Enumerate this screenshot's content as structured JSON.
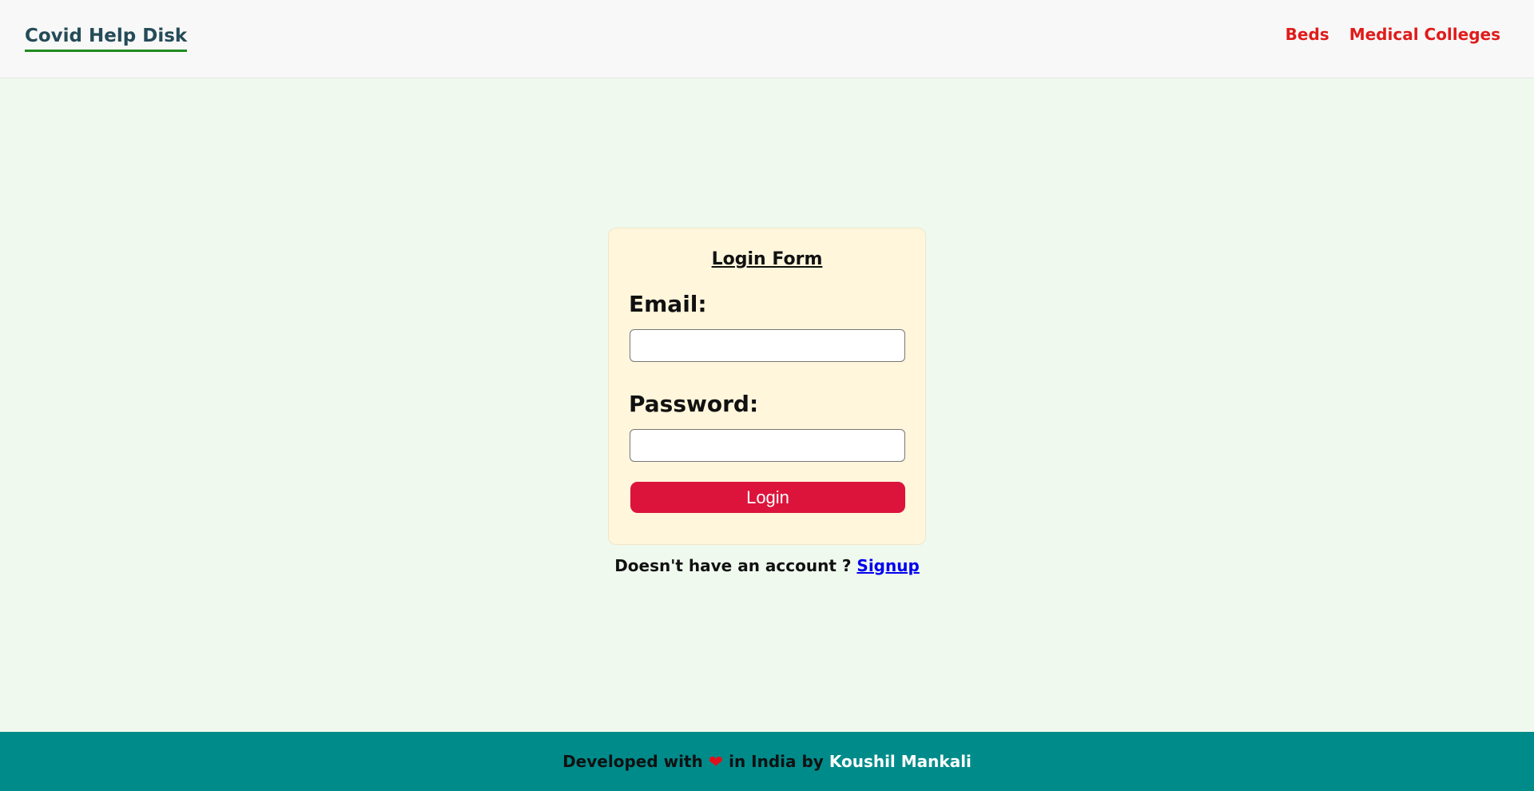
{
  "nav": {
    "brand": "Covid Help Disk",
    "links": [
      "Beds",
      "Medical Colleges"
    ],
    "link_color": "#e01b1b"
  },
  "login_form": {
    "title": "Login Form",
    "email_label": "Email:",
    "email_value": "",
    "password_label": "Password:",
    "password_value": "",
    "submit_label": "Login",
    "submit_color": "#dc143c"
  },
  "signup": {
    "prompt": "Doesn't have an account ?",
    "link_label": "Signup"
  },
  "footer": {
    "text_before": "Developed with",
    "heart_icon": "heart-icon",
    "text_after": "in India by",
    "author": "Koushil Mankali",
    "background": "#008b8b"
  }
}
